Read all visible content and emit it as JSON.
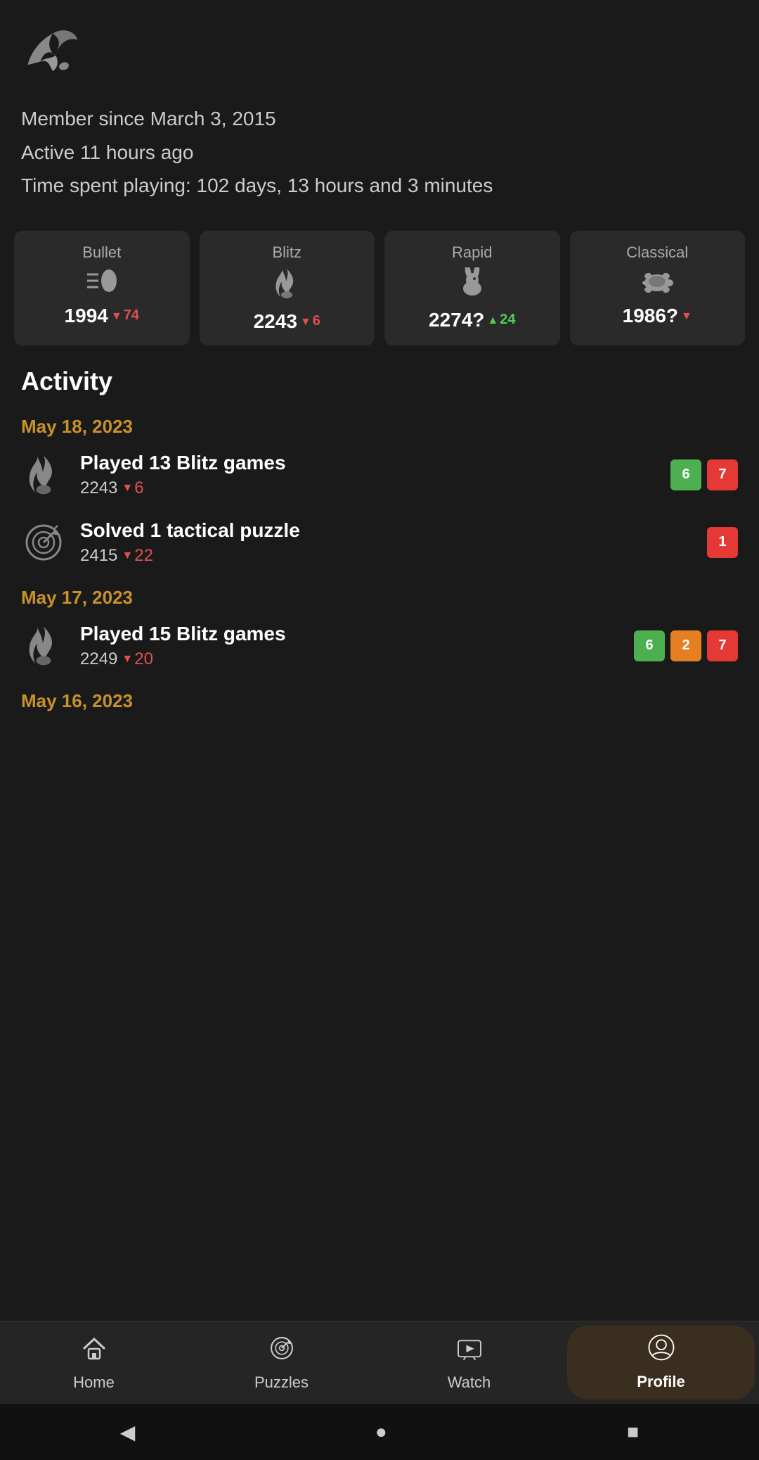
{
  "header": {
    "logo_alt": "Lichess logo"
  },
  "member_info": {
    "since": "Member since March 3, 2015",
    "active": "Active 11 hours ago",
    "time_playing": "Time spent playing: 102 days, 13 hours and 3 minutes"
  },
  "rating_cards": [
    {
      "label": "Bullet",
      "icon": "bullet",
      "rating": "1994",
      "delta": "74",
      "delta_dir": "down"
    },
    {
      "label": "Blitz",
      "icon": "flame",
      "rating": "2243",
      "delta": "6",
      "delta_dir": "down"
    },
    {
      "label": "Rapid",
      "icon": "rabbit",
      "rating": "2274?",
      "delta": "24",
      "delta_dir": "up"
    },
    {
      "label": "Classical",
      "icon": "turtle",
      "rating": "1986?",
      "delta": "?",
      "delta_dir": "down"
    }
  ],
  "activity": {
    "section_title": "Activity",
    "groups": [
      {
        "date": "May 18, 2023",
        "items": [
          {
            "type": "blitz",
            "description": "Played 13 Blitz games",
            "rating": "2243",
            "delta": "6",
            "delta_dir": "down",
            "badges": [
              {
                "value": "6",
                "color": "green"
              },
              {
                "value": "7",
                "color": "red"
              }
            ]
          },
          {
            "type": "puzzle",
            "description": "Solved 1 tactical puzzle",
            "rating": "2415",
            "delta": "22",
            "delta_dir": "down",
            "badges": [
              {
                "value": "1",
                "color": "red"
              }
            ]
          }
        ]
      },
      {
        "date": "May 17, 2023",
        "items": [
          {
            "type": "blitz",
            "description": "Played 15 Blitz games",
            "rating": "2249",
            "delta": "20",
            "delta_dir": "down",
            "badges": [
              {
                "value": "6",
                "color": "green"
              },
              {
                "value": "2",
                "color": "orange"
              },
              {
                "value": "7",
                "color": "red"
              }
            ]
          }
        ]
      },
      {
        "date": "May 16, 2023",
        "items": []
      }
    ]
  },
  "bottom_nav": {
    "items": [
      {
        "label": "Home",
        "icon": "home",
        "active": false
      },
      {
        "label": "Puzzles",
        "icon": "target",
        "active": false
      },
      {
        "label": "Watch",
        "icon": "tv",
        "active": false
      },
      {
        "label": "Profile",
        "icon": "person",
        "active": true
      }
    ]
  },
  "android_nav": {
    "back": "◀",
    "home": "●",
    "recent": "■"
  }
}
